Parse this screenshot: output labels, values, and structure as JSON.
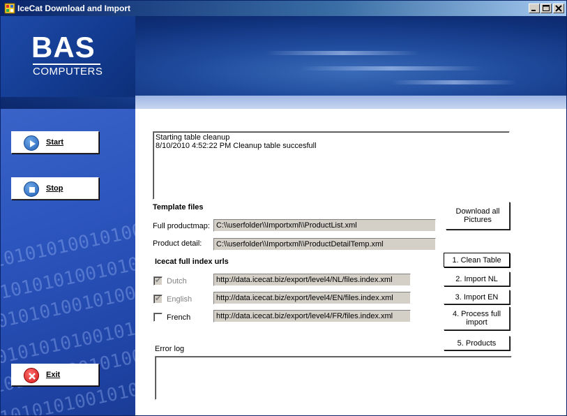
{
  "window": {
    "title": "IceCat Download and Import",
    "controls": {
      "minimize": "_",
      "maximize": "□",
      "close": "✕"
    }
  },
  "banner": {
    "logo_main": "BAS",
    "logo_sub": "COMPUTERS",
    "decoration": "01010101001010010100101"
  },
  "sidebar": {
    "start_label": "Start",
    "stop_label": "Stop",
    "exit_label": "Exit"
  },
  "log": {
    "lines": [
      "Starting table cleanup",
      "8/10/2010 4:52:22 PM Cleanup table succesfull"
    ]
  },
  "template_files": {
    "heading": "Template files",
    "full_productmap_label": "Full productmap:",
    "full_productmap_value": "C:\\\\userfolder\\\\Importxml\\\\ProductList.xml",
    "product_detail_label": "Product detail:",
    "product_detail_value": "C:\\\\userfolder\\\\Importxml\\\\ProductDetailTemp.xml"
  },
  "index_urls": {
    "heading": "Icecat full index urls",
    "languages": [
      {
        "label": "Dutch",
        "checked": true,
        "enabled": false,
        "url": "http://data.icecat.biz/export/level4/NL/files.index.xml"
      },
      {
        "label": "English",
        "checked": true,
        "enabled": false,
        "url": "http://data.icecat.biz/export/level4/EN/files.index.xml"
      },
      {
        "label": "French",
        "checked": false,
        "enabled": true,
        "url": "http://data.icecat.biz/export/level4/FR/files.index.xml"
      }
    ]
  },
  "actions": {
    "download_pictures": "Download all Pictures",
    "clean_table": "1. Clean Table",
    "import_nl": "2. Import NL",
    "import_en": "3. Import EN",
    "process_full_import": "4. Process full import",
    "products": "5. Products"
  },
  "error_log": {
    "label": "Error log",
    "content": ""
  }
}
